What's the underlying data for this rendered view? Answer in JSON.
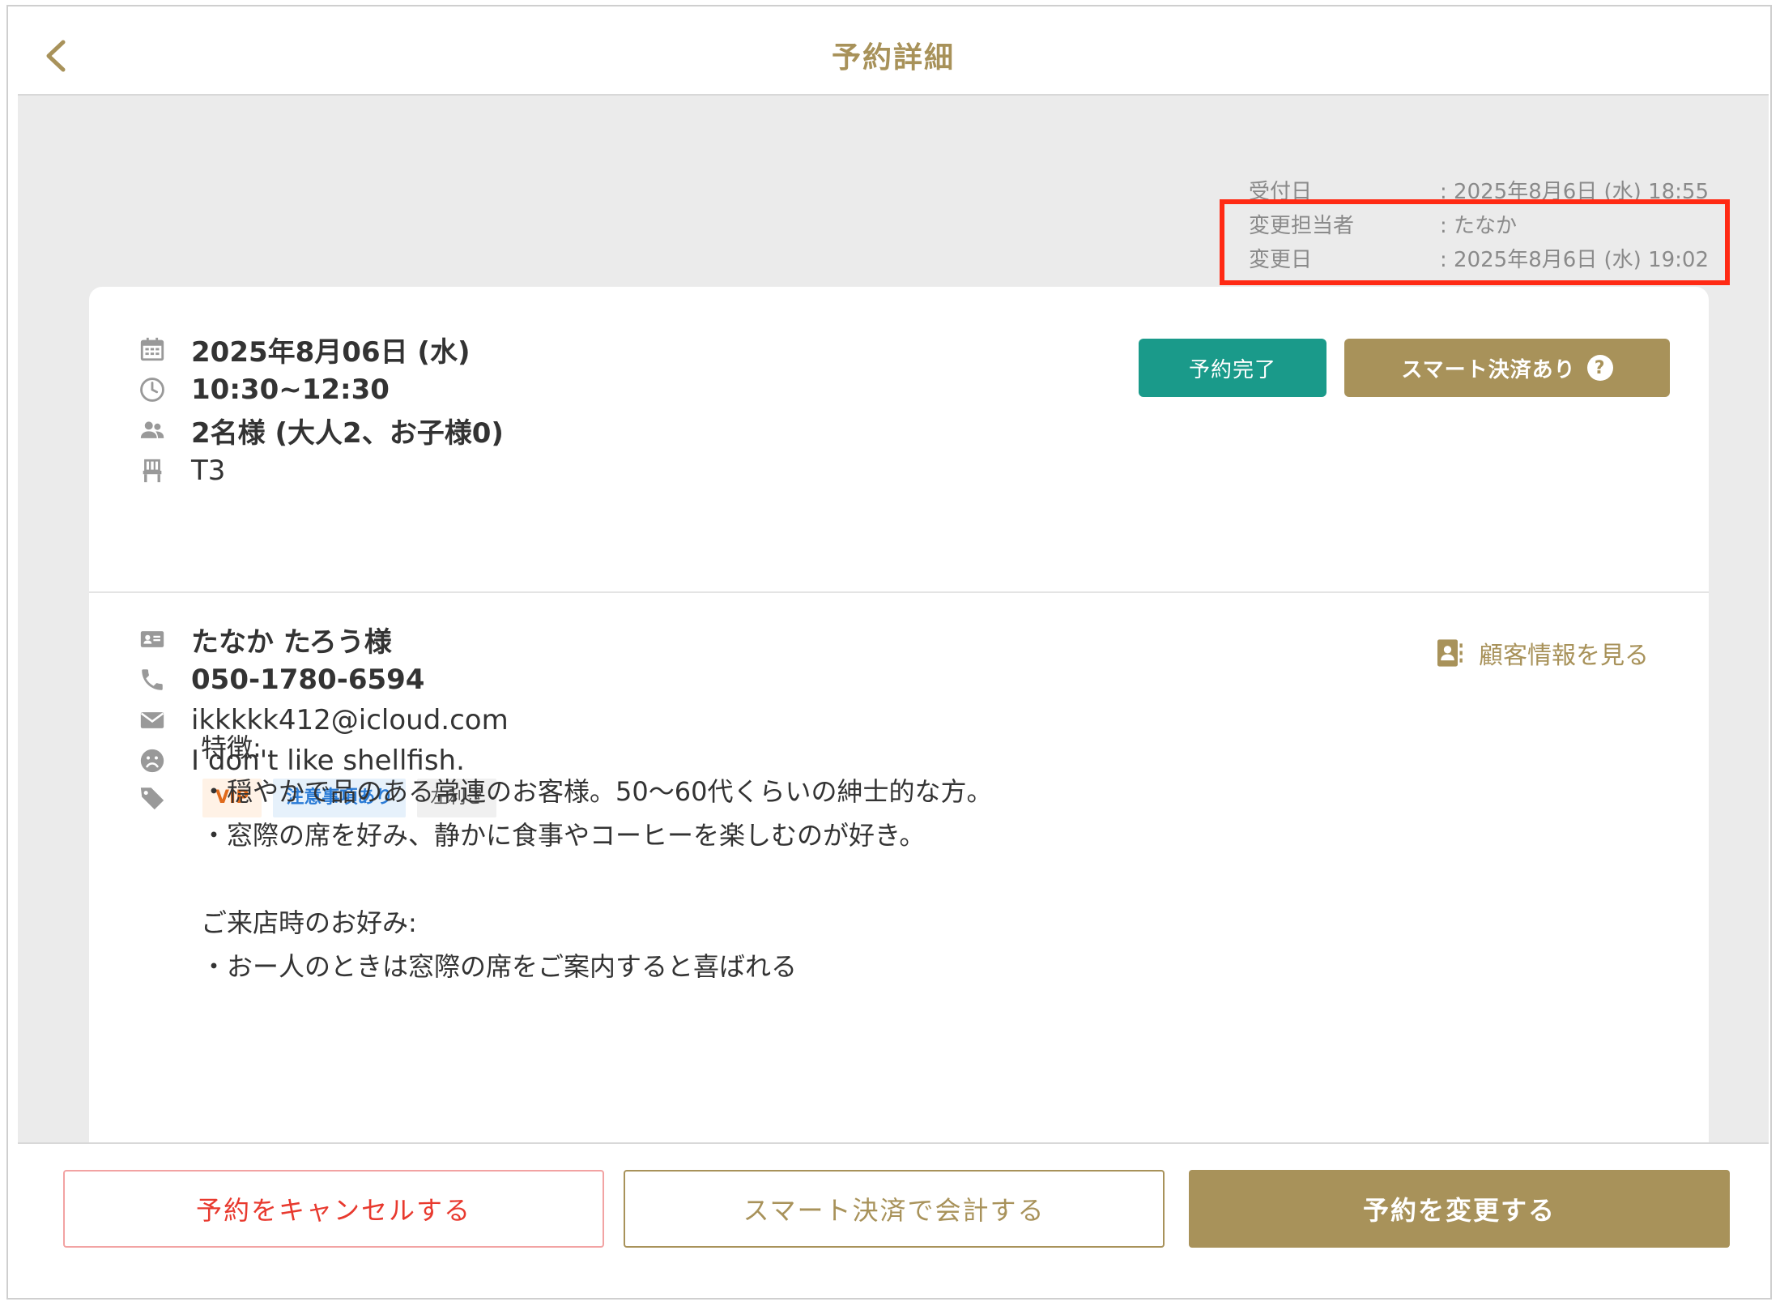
{
  "header": {
    "title": "予約詳細"
  },
  "meta": [
    {
      "key": "受付日",
      "value": ": 2025年8月6日 (水) 18:55"
    },
    {
      "key": "変更担当者",
      "value": ": たなか"
    },
    {
      "key": "変更日",
      "value": ": 2025年8月6日 (水) 19:02"
    }
  ],
  "reservation": {
    "date": "2025年8月06日 (水)",
    "time": "10:30~12:30",
    "guests": "2名様 (大人2、お子様0)",
    "table": "T3",
    "status_label": "予約完了",
    "smart_label": "スマート決済あり",
    "smart_help": "?"
  },
  "customer": {
    "name": "たなか たろう様",
    "phone": "050-1780-6594",
    "email": "ikkkkk412@icloud.com",
    "dislike": "I don't like shellfish.",
    "link_label": "顧客情報を見る",
    "tags": [
      "VIP",
      "注意事項あり",
      "左利き"
    ],
    "notes": "特徴:\n・穏やかで品のある常連のお客様。50～60代くらいの紳士的な方。\n・窓際の席を好み、静かに食事やコーヒーを楽しむのが好き。\n\nご来店時のお好み:\n・おー人のときは窓際の席をご案内すると喜ばれる"
  },
  "footer": {
    "cancel_label": "予約をキャンセルする",
    "smart_pay_label": "スマート決済で会計する",
    "change_label": "予約を変更する"
  },
  "colors": {
    "accent": "#a8925a",
    "status": "#1a9a8a",
    "danger": "#e8392e",
    "highlight": "#ff2a14"
  }
}
